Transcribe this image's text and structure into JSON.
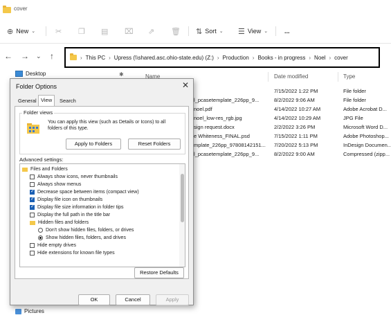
{
  "window": {
    "title": "cover"
  },
  "toolbar": {
    "new_label": "New",
    "sort_label": "Sort",
    "view_label": "View",
    "more_label": "..."
  },
  "address": {
    "segments": [
      "This PC",
      "Upress (\\\\shared.asc.ohio-state.edu) (Z:)",
      "Production",
      "Books - in progress",
      "Noel",
      "cover"
    ]
  },
  "nav": {
    "desktop_label": "Desktop",
    "pictures_label": "Pictures"
  },
  "filelist": {
    "headers": {
      "name": "Name",
      "date": "Date modified",
      "type": "Type"
    },
    "rows": [
      {
        "name": "",
        "date": "7/15/2022 1:22 PM",
        "type": "File folder"
      },
      {
        "name": "l_pcasetemplate_226pp_9...",
        "date": "8/2/2022 9:06 AM",
        "type": "File folder"
      },
      {
        "name": "noel.pdf",
        "date": "4/14/2022 10:27 AM",
        "type": "Adobe Acrobat D..."
      },
      {
        "name": "noel_low-res_rgb.jpg",
        "date": "4/14/2022 10:29 AM",
        "type": "JPG File"
      },
      {
        "name": "sign request.docx",
        "date": "2/2/2022 3:26 PM",
        "type": "Microsoft Word D..."
      },
      {
        "name": "e Whiteness_FINAL.psd",
        "date": "7/15/2022 1:11 PM",
        "type": "Adobe Photoshop..."
      },
      {
        "name": "mplate_226pp_97808142151...",
        "date": "7/20/2022 5:13 PM",
        "type": "InDesign Documen..."
      },
      {
        "name": "l_pcasetemplate_226pp_9...",
        "date": "8/2/2022 9:00 AM",
        "type": "Compressed (zipp..."
      }
    ]
  },
  "dialog": {
    "title": "Folder Options",
    "tabs": [
      "General",
      "View",
      "Search"
    ],
    "active_tab": "View",
    "folder_views": {
      "legend": "Folder views",
      "description": "You can apply this view (such as Details or Icons) to all folders of this type.",
      "apply_button": "Apply to Folders",
      "reset_button": "Reset Folders"
    },
    "advanced_label": "Advanced settings:",
    "advanced_items": [
      {
        "kind": "folder",
        "label": "Files and Folders"
      },
      {
        "kind": "checkbox",
        "label": "Always show icons, never thumbnails",
        "checked": false
      },
      {
        "kind": "checkbox",
        "label": "Always show menus",
        "checked": false
      },
      {
        "kind": "checkbox",
        "label": "Decrease space between items (compact view)",
        "checked": true
      },
      {
        "kind": "checkbox",
        "label": "Display file icon on thumbnails",
        "checked": true
      },
      {
        "kind": "checkbox",
        "label": "Display file size information in folder tips",
        "checked": true
      },
      {
        "kind": "checkbox",
        "label": "Display the full path in the title bar",
        "checked": false
      },
      {
        "kind": "folder",
        "label": "Hidden files and folders"
      },
      {
        "kind": "radio",
        "label": "Don't show hidden files, folders, or drives",
        "checked": false
      },
      {
        "kind": "radio",
        "label": "Show hidden files, folders, and drives",
        "checked": true
      },
      {
        "kind": "checkbox",
        "label": "Hide empty drives",
        "checked": false
      },
      {
        "kind": "checkbox",
        "label": "Hide extensions for known file types",
        "checked": false
      }
    ],
    "restore_button": "Restore Defaults",
    "ok_button": "OK",
    "cancel_button": "Cancel",
    "apply_button": "Apply"
  }
}
